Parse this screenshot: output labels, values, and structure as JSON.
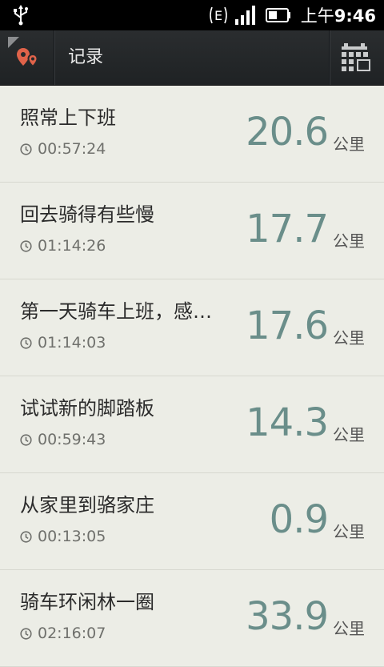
{
  "status_bar": {
    "network_letter": "E",
    "time_prefix": "上午",
    "time": "9:46",
    "icons": [
      "usb-icon",
      "network-e-icon",
      "signal-icon",
      "battery-icon"
    ]
  },
  "app_bar": {
    "title": "记录",
    "logo_icon": "location-pins-icon",
    "calendar_icon": "calendar-icon"
  },
  "colors": {
    "distance": "#6a8e8a",
    "background": "#ecede6",
    "header": "#24272a",
    "logo": "#e0634a"
  },
  "records": [
    {
      "name": "照常上下班",
      "duration": "00:57:24",
      "distance": "20.6",
      "unit": "公里"
    },
    {
      "name": "回去骑得有些慢",
      "duration": "01:14:26",
      "distance": "17.7",
      "unit": "公里"
    },
    {
      "name": "第一天骑车上班，感…",
      "duration": "01:14:03",
      "distance": "17.6",
      "unit": "公里"
    },
    {
      "name": "试试新的脚踏板",
      "duration": "00:59:43",
      "distance": "14.3",
      "unit": "公里"
    },
    {
      "name": "从家里到骆家庄",
      "duration": "00:13:05",
      "distance": "0.9",
      "unit": "公里"
    },
    {
      "name": "骑车环闲林一圈",
      "duration": "02:16:07",
      "distance": "33.9",
      "unit": "公里"
    }
  ]
}
